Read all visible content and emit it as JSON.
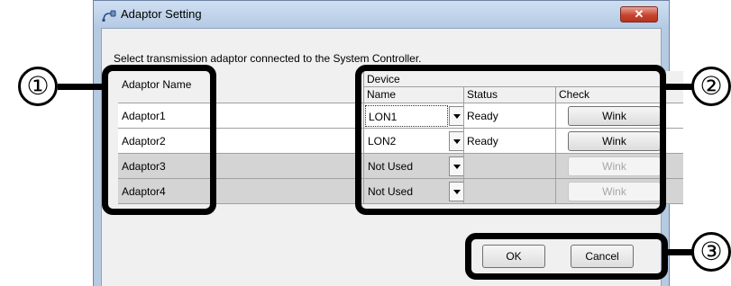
{
  "window": {
    "title": "Adaptor Setting",
    "close_glyph": "✕"
  },
  "instruction": "Select transmission adaptor connected to the System Controller.",
  "grid": {
    "headers": {
      "adaptor_name": "Adaptor Name",
      "device_group": "Device",
      "name": "Name",
      "status": "Status",
      "check": "Check"
    },
    "rows": [
      {
        "adaptor": "Adaptor1",
        "device": "LON1",
        "status": "Ready",
        "wink": "Wink",
        "enabled": true
      },
      {
        "adaptor": "Adaptor2",
        "device": "LON2",
        "status": "Ready",
        "wink": "Wink",
        "enabled": true
      },
      {
        "adaptor": "Adaptor3",
        "device": "Not Used",
        "status": "",
        "wink": "Wink",
        "enabled": false
      },
      {
        "adaptor": "Adaptor4",
        "device": "Not Used",
        "status": "",
        "wink": "Wink",
        "enabled": false
      }
    ]
  },
  "buttons": {
    "ok": "OK",
    "cancel": "Cancel"
  },
  "callouts": {
    "one": "①",
    "two": "②",
    "three": "③"
  },
  "icons": {
    "title": "adaptor-plug-icon",
    "close": "close-icon",
    "dropdown": "chevron-down-icon"
  },
  "colors": {
    "title_bar": "#b8cde6",
    "close_button": "#c9442f",
    "disabled_row": "#d4d4d4",
    "callout": "#000000"
  }
}
